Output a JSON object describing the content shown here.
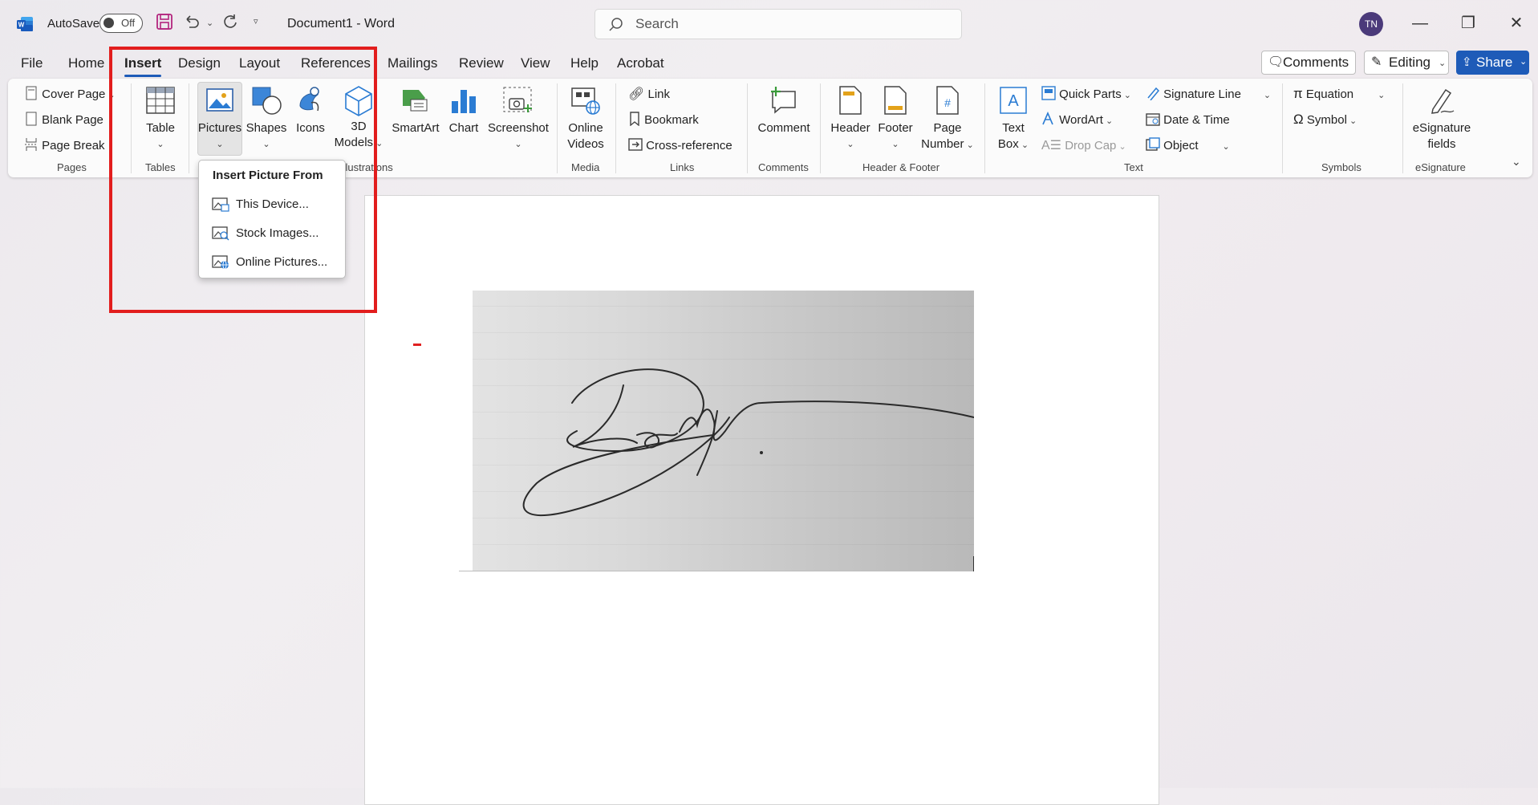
{
  "titlebar": {
    "autosave_label": "AutoSave",
    "autosave_state": "Off",
    "document_title": "Document1  -  Word",
    "search_placeholder": "Search",
    "user_initials": "TN"
  },
  "tabs": [
    "File",
    "Home",
    "Insert",
    "Design",
    "Layout",
    "References",
    "Mailings",
    "Review",
    "View",
    "Help",
    "Acrobat"
  ],
  "active_tab": "Insert",
  "top_right": {
    "comments": "Comments",
    "editing": "Editing",
    "share": "Share"
  },
  "ribbon": {
    "pages": {
      "cover_page": "Cover Page",
      "blank_page": "Blank Page",
      "page_break": "Page Break",
      "group": "Pages"
    },
    "tables": {
      "table": "Table",
      "group": "Tables"
    },
    "illustrations": {
      "pictures": "Pictures",
      "shapes": "Shapes",
      "icons": "Icons",
      "models_line1": "3D",
      "models_line2": "Models",
      "smartart": "SmartArt",
      "chart": "Chart",
      "screenshot": "Screenshot",
      "group": "Illustrations"
    },
    "media": {
      "online_line1": "Online",
      "online_line2": "Videos",
      "group": "Media"
    },
    "links": {
      "link": "Link",
      "bookmark": "Bookmark",
      "cross_reference": "Cross-reference",
      "group": "Links"
    },
    "comments": {
      "comment": "Comment",
      "group": "Comments"
    },
    "header_footer": {
      "header": "Header",
      "footer": "Footer",
      "page_line1": "Page",
      "page_line2": "Number",
      "group": "Header & Footer"
    },
    "text": {
      "textbox_line1": "Text",
      "textbox_line2": "Box",
      "quick_parts": "Quick Parts",
      "wordart": "WordArt",
      "drop_cap": "Drop Cap",
      "signature_line": "Signature Line",
      "date_time": "Date & Time",
      "object": "Object",
      "group": "Text"
    },
    "symbols": {
      "equation": "Equation",
      "symbol": "Symbol",
      "group": "Symbols"
    },
    "esignature": {
      "line1": "eSignature",
      "line2": "fields",
      "group": "eSignature"
    }
  },
  "pictures_menu": {
    "header": "Insert Picture From",
    "items": [
      "This Device...",
      "Stock Images...",
      "Online Pictures..."
    ]
  },
  "colors": {
    "accent": "#1e5bb8",
    "highlight": "#e21d1d",
    "word_blue": "#185abd"
  }
}
